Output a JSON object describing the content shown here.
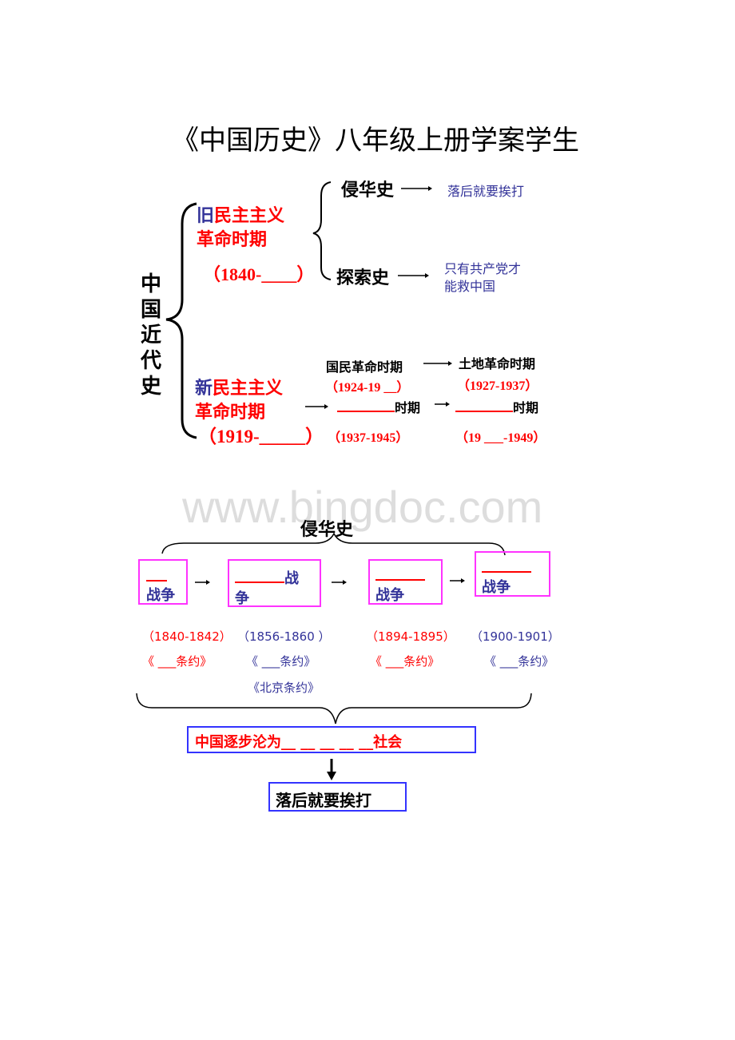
{
  "title": "《中国历史》八年级上册学案学生",
  "top_diagram": {
    "root_label": [
      "中",
      "国",
      "近",
      "代",
      "史"
    ],
    "old_period": {
      "prefix": "旧",
      "name_rest": "民主主义",
      "line2": "革命时期",
      "years": "（1840-____）"
    },
    "branches": [
      {
        "label": "侵华史",
        "arrow": "—→",
        "conclusion": "落后就要挨打"
      },
      {
        "label": "探索史",
        "arrow": "—→",
        "conclusion_line1": "只有共产党才",
        "conclusion_line2": "能救中国"
      }
    ],
    "new_period": {
      "prefix": "新",
      "name_rest": "民主主义",
      "line2": "革命时期",
      "years": "（1919-_____）"
    },
    "stages": [
      {
        "name": "国民革命时期",
        "years": "（1924-19 __）"
      },
      {
        "name": "土地革命时期",
        "years": "（1927-1937）"
      },
      {
        "blank": "_______",
        "suffix": "时期",
        "years": "（1937-1945）"
      },
      {
        "blank": "_______",
        "suffix": "时期",
        "years": "（19 ___-1949）"
      }
    ]
  },
  "watermark": "www.bingdoc.com",
  "bottom_diagram": {
    "header": "侵华史",
    "wars": [
      {
        "blank": "___",
        "label": "战争",
        "years": "（1840-1842）",
        "treaty": "《 ___条约》",
        "color": "#ff0000"
      },
      {
        "blank": "______",
        "label_a": "战",
        "label_b": "争",
        "years": "（1856-1860 ）",
        "treaty": "《 ___条约》",
        "extra_treaty": "《北京条约》",
        "color": "#333399"
      },
      {
        "blank": "______",
        "label": "战争",
        "years": "（1894-1895）",
        "treaty": "《 ___条约》",
        "color": "#ff0000"
      },
      {
        "blank": "______",
        "label": "战争",
        "years": "（1900-1901）",
        "treaty": "《 ___条约》",
        "color": "#333399"
      }
    ],
    "arrow": "→",
    "result": "中国逐步沦为__ __ __ __ __社会",
    "result_prefix": "中国逐步沦为",
    "result_blanks": "__ __ __ __ __",
    "result_suffix": "社会",
    "conclusion": "落后就要挨打"
  },
  "colors": {
    "red": "#ff0000",
    "blue": "#333399",
    "magenta": "#ff33ff",
    "box_blue": "#3333ff"
  }
}
